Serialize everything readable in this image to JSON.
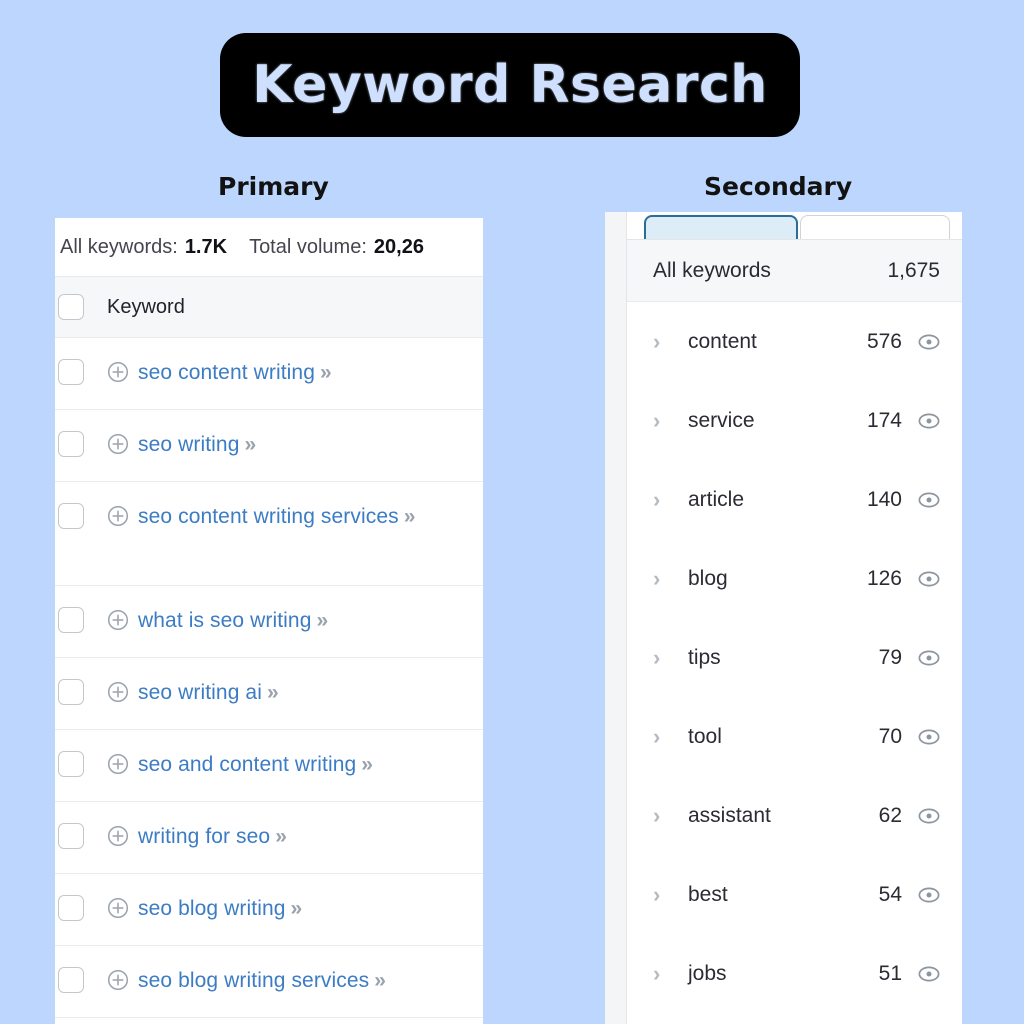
{
  "title": {
    "text": "Keyword Rsearch",
    "badge_bg": "#000000",
    "text_color": "#cfe0ff"
  },
  "page": {
    "background": "#bcd6fd"
  },
  "captions": {
    "primary": "Primary",
    "secondary": "Secondary"
  },
  "primary_panel": {
    "summary": {
      "all_keywords_label": "All keywords:",
      "all_keywords_value": "1.7K",
      "total_volume_label": "Total volume:",
      "total_volume_value": "20,26"
    },
    "column_header": "Keyword",
    "plus_icon": "circled-plus-icon",
    "expand_glyph": "»",
    "link_color": "#3c7cc5",
    "rows": [
      {
        "keyword": "seo content writing"
      },
      {
        "keyword": "seo writing"
      },
      {
        "keyword": "seo content writing services"
      },
      {
        "keyword": "what is seo writing"
      },
      {
        "keyword": "seo writing ai"
      },
      {
        "keyword": "seo and content writing"
      },
      {
        "keyword": "writing for seo"
      },
      {
        "keyword": "seo blog writing"
      },
      {
        "keyword": "seo blog writing services"
      }
    ]
  },
  "secondary_panel": {
    "tabs": [
      {
        "label": "",
        "active": true
      },
      {
        "label": "",
        "active": false
      }
    ],
    "all_keywords": {
      "label": "All keywords",
      "count": "1,675"
    },
    "expand_glyph": "›",
    "visibility_icon": "eye-icon",
    "groups": [
      {
        "label": "content",
        "count": "576"
      },
      {
        "label": "service",
        "count": "174"
      },
      {
        "label": "article",
        "count": "140"
      },
      {
        "label": "blog",
        "count": "126"
      },
      {
        "label": "tips",
        "count": "79"
      },
      {
        "label": "tool",
        "count": "70"
      },
      {
        "label": "assistant",
        "count": "62"
      },
      {
        "label": "best",
        "count": "54"
      },
      {
        "label": "jobs",
        "count": "51"
      }
    ]
  }
}
